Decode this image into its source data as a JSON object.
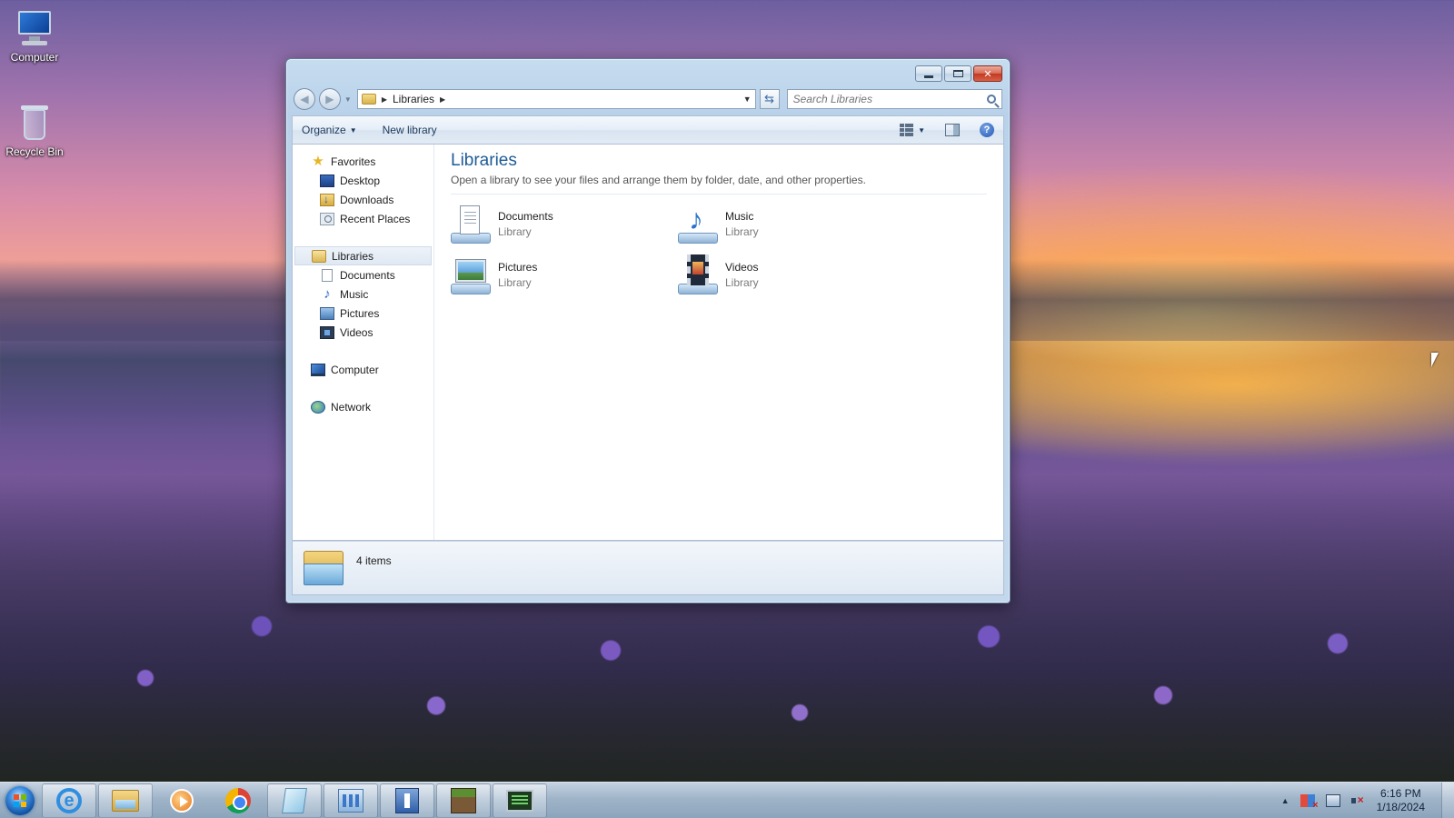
{
  "desktop": {
    "icons": [
      {
        "label": "Computer",
        "icon": "computer-icon"
      },
      {
        "label": "Recycle Bin",
        "icon": "recycle-bin-icon"
      }
    ]
  },
  "window": {
    "address": {
      "crumbs": [
        "Libraries"
      ]
    },
    "search": {
      "placeholder": "Search Libraries"
    },
    "commandbar": {
      "organize": "Organize",
      "new_library": "New library"
    },
    "navpane": {
      "favorites": {
        "label": "Favorites",
        "items": [
          "Desktop",
          "Downloads",
          "Recent Places"
        ]
      },
      "libraries": {
        "label": "Libraries",
        "items": [
          "Documents",
          "Music",
          "Pictures",
          "Videos"
        ]
      },
      "computer": "Computer",
      "network": "Network"
    },
    "content": {
      "title": "Libraries",
      "subtitle": "Open a library to see your files and arrange them by folder, date, and other properties.",
      "libraries": [
        {
          "name": "Documents",
          "type": "Library",
          "icon": "documents-library-icon"
        },
        {
          "name": "Music",
          "type": "Library",
          "icon": "music-library-icon"
        },
        {
          "name": "Pictures",
          "type": "Library",
          "icon": "pictures-library-icon"
        },
        {
          "name": "Videos",
          "type": "Library",
          "icon": "videos-library-icon"
        }
      ]
    },
    "details": {
      "count": "4 items"
    }
  },
  "taskbar": {
    "pinned": [
      "internet-explorer-icon",
      "windows-explorer-icon",
      "media-player-icon",
      "chrome-icon",
      "notepad-icon",
      "control-panel-icon",
      "document-app-icon",
      "minecraft-icon",
      "task-monitor-icon"
    ],
    "clock": {
      "time": "6:16 PM",
      "date": "1/18/2024"
    }
  },
  "colors": {
    "title_blue": "#1e5b96",
    "window_frame": "#b9d2ea",
    "close_red": "#c2391e"
  }
}
